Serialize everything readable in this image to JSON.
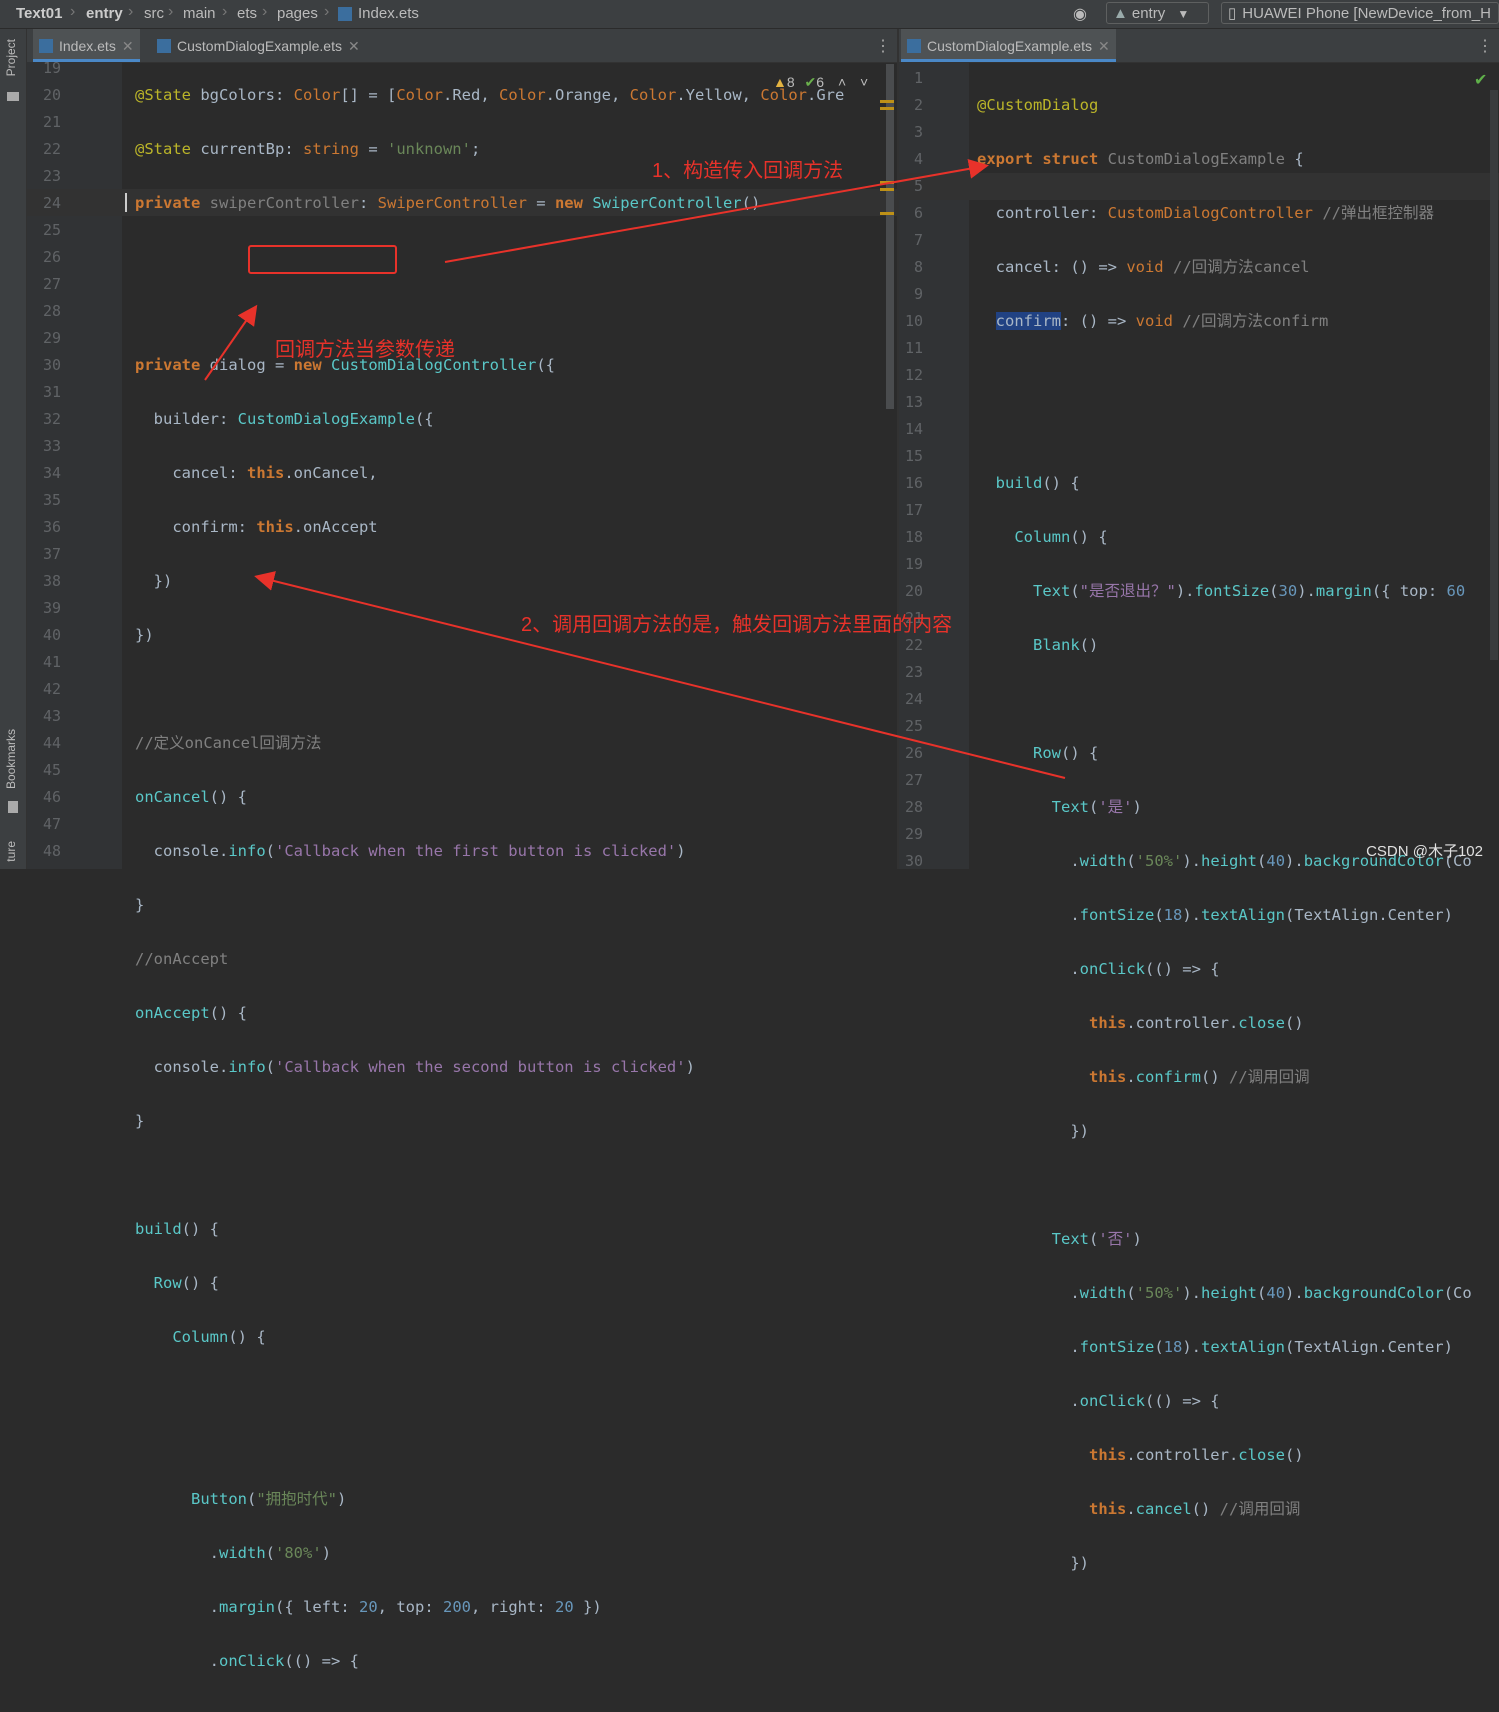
{
  "breadcrumb": [
    "Text01",
    "entry",
    "src",
    "main",
    "ets",
    "pages",
    "Index.ets"
  ],
  "toolbar": {
    "module_label": "entry",
    "device_label": "HUAWEI Phone [NewDevice_from_H"
  },
  "side": {
    "project_label": "Project",
    "bookmarks_label": "Bookmarks",
    "structure_label": "ture"
  },
  "left_tabs": [
    {
      "label": "Index.ets",
      "active": true
    },
    {
      "label": "CustomDialogExample.ets",
      "active": false
    }
  ],
  "right_tabs": [
    {
      "label": "CustomDialogExample.ets",
      "active": true
    }
  ],
  "inspections": {
    "warnings": "8",
    "ok": "6"
  },
  "left_editor": {
    "line_numbers": [
      "19",
      "20",
      "21",
      "22",
      "23",
      "24",
      "25",
      "26",
      "27",
      "28",
      "29",
      "30",
      "31",
      "32",
      "33",
      "34",
      "35",
      "36",
      "37",
      "38",
      "39",
      "40",
      "41",
      "42",
      "43",
      "44",
      "45",
      "46",
      "47",
      "48"
    ],
    "lines": [
      "@State bgColors: Color[] = [Color.Red, Color.Orange, Color.Yellow, Color.Gre",
      "@State currentBp: string = 'unknown';",
      "private swiperController: SwiperController = new SwiperController()",
      "",
      "",
      "private dialog = new CustomDialogController({",
      "  builder: CustomDialogExample({",
      "    cancel: this.onCancel,",
      "    confirm: this.onAccept",
      "  })",
      "})",
      "",
      "//定义onCancel回调方法",
      "onCancel() {",
      "  console.info('Callback when the first button is clicked')",
      "}",
      "//onAccept",
      "onAccept() {",
      "  console.info('Callback when the second button is clicked')",
      "}",
      "",
      "build() {",
      "  Row() {",
      "    Column() {",
      "",
      "",
      "      Button(\"拥抱时代\")",
      "        .width('80%')",
      "        .margin({ left: 20, top: 200, right: 20 })",
      "        .onClick(() => {"
    ]
  },
  "right_editor": {
    "line_numbers": [
      "1",
      "2",
      "3",
      "4",
      "5",
      "6",
      "7",
      "8",
      "9",
      "10",
      "11",
      "12",
      "13",
      "14",
      "15",
      "16",
      "17",
      "18",
      "19",
      "20",
      "21",
      "22",
      "23",
      "24",
      "25",
      "26",
      "27",
      "28",
      "29",
      "30"
    ],
    "lines": [
      "@CustomDialog",
      "export struct CustomDialogExample {",
      "  controller: CustomDialogController //弹出框控制器",
      "  cancel: () => void //回调方法cancel",
      "  confirm: () => void //回调方法confirm",
      "",
      "",
      "  build() {",
      "    Column() {",
      "      Text(\"是否退出？\").fontSize(30).margin({ top: 60",
      "      Blank()",
      "",
      "      Row() {",
      "        Text('是')",
      "          .width('50%').height(40).backgroundColor(Co",
      "          .fontSize(18).textAlign(TextAlign.Center)",
      "          .onClick(() => {",
      "            this.controller.close()",
      "            this.confirm() //调用回调",
      "          })",
      "",
      "        Text('否')",
      "          .width('50%').height(40).backgroundColor(Co",
      "          .fontSize(18).textAlign(TextAlign.Center)",
      "          .onClick(() => {",
      "            this.controller.close()",
      "            this.cancel() //调用回调",
      "          })",
      "",
      ""
    ]
  },
  "annotations": {
    "step1": "1、构造传入回调方法",
    "param": "回调方法当参数传递",
    "step2": "2、调用回调方法的是，触发回调方法里面的内容"
  },
  "watermark": "CSDN @木子102",
  "colors": {
    "annotation": "#e8322a",
    "background": "#2b2b2b",
    "keyword": "#cc7832",
    "string": "#6a8759"
  }
}
